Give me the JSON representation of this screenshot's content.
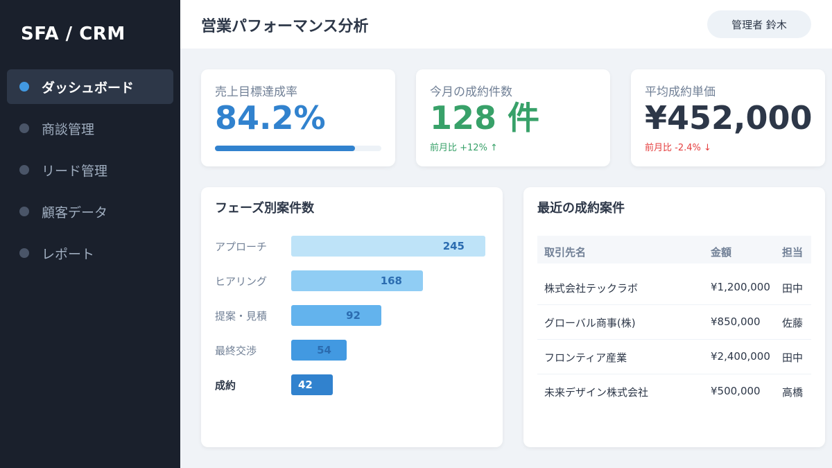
{
  "sidebar": {
    "brand": "SFA / CRM",
    "items": [
      {
        "label": "ダッシュボード"
      },
      {
        "label": "商談管理"
      },
      {
        "label": "リード管理"
      },
      {
        "label": "顧客データ"
      },
      {
        "label": "レポート"
      }
    ]
  },
  "header": {
    "title": "営業パフォーマンス分析",
    "user": "管理者 鈴木"
  },
  "kpis": {
    "target": {
      "label": "売上目標達成率",
      "value": "84.2%",
      "progress": 0.842
    },
    "deals": {
      "label": "今月の成約件数",
      "value": "128 件",
      "change": "前月比 +12% ↑"
    },
    "avg": {
      "label": "平均成約単価",
      "value": "¥452,000",
      "change": "前月比 -2.4% ↓"
    }
  },
  "phase_chart": {
    "title": "フェーズ別案件数",
    "rows": [
      {
        "label": "アプローチ",
        "value": "245"
      },
      {
        "label": "ヒアリング",
        "value": "168"
      },
      {
        "label": "提案・見積",
        "value": "92"
      },
      {
        "label": "最終交渉",
        "value": "54"
      },
      {
        "label": "成約",
        "value": "42"
      }
    ],
    "colors": [
      "#bee3f8",
      "#90cdf4",
      "#63b3ed",
      "#4299e1",
      "#3182ce"
    ]
  },
  "deals_table": {
    "title": "最近の成約案件",
    "headers": [
      "取引先名",
      "金額",
      "担当"
    ],
    "rows": [
      [
        "株式会社テックラボ",
        "¥1,200,000",
        "田中"
      ],
      [
        "グローバル商事(株)",
        "¥850,000",
        "佐藤"
      ],
      [
        "フロンティア産業",
        "¥2,400,000",
        "田中"
      ],
      [
        "未来デザイン株式会社",
        "¥500,000",
        "高橋"
      ]
    ]
  },
  "colors": {
    "sidebar": "#1a202c",
    "accent_blue": "#3182ce",
    "accent_green": "#38a169",
    "accent_red": "#e53e3e"
  }
}
